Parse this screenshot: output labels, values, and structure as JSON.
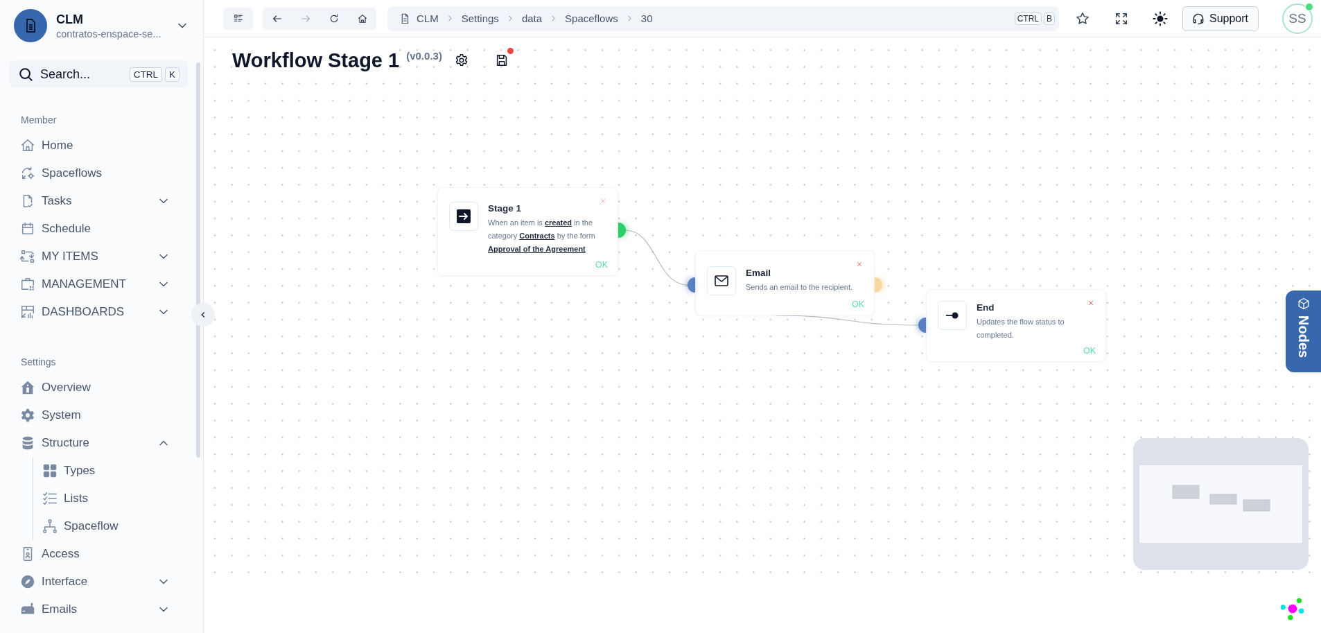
{
  "sidebar": {
    "workspace": {
      "name": "CLM",
      "subtitle": "contratos-enspace-se..."
    },
    "search": {
      "label": "Search...",
      "keys": [
        "CTRL",
        "K"
      ]
    },
    "sections": [
      {
        "title": "Member",
        "items": [
          {
            "label": "Home"
          },
          {
            "label": "Spaceflows"
          },
          {
            "label": "Tasks",
            "expanded": false
          },
          {
            "label": "Schedule"
          },
          {
            "label": "MY ITEMS",
            "expanded": false
          },
          {
            "label": "MANAGEMENT",
            "expanded": false
          },
          {
            "label": "DASHBOARDS",
            "expanded": false
          }
        ]
      },
      {
        "title": "Settings",
        "items": [
          {
            "label": "Overview"
          },
          {
            "label": "System"
          },
          {
            "label": "Structure",
            "expanded": true,
            "children": [
              {
                "label": "Types"
              },
              {
                "label": "Lists"
              },
              {
                "label": "Spaceflow"
              }
            ]
          },
          {
            "label": "Access"
          },
          {
            "label": "Interface",
            "expanded": false
          },
          {
            "label": "Emails",
            "expanded": false
          }
        ]
      }
    ]
  },
  "toolbar": {
    "nav_buttons": [
      {
        "kind": "back",
        "disabled": false
      },
      {
        "kind": "forward",
        "disabled": true
      },
      {
        "kind": "reload",
        "disabled": false
      },
      {
        "kind": "home",
        "disabled": false
      }
    ],
    "breadcrumbs": [
      "CLM",
      "Settings",
      "data",
      "Spaceflows",
      "30"
    ],
    "shortcut": [
      "CTRL",
      "B"
    ],
    "support": "Support",
    "avatar": {
      "initials": "SS",
      "online": true
    }
  },
  "workflow": {
    "title": "Workflow Stage 1",
    "version": "(v0.0.3)",
    "unsaved": true,
    "nodes": [
      {
        "kind": "trigger",
        "title": "Stage 1",
        "description": "When an item is **created** in the category **Contracts** by the form **Approval of the Agreement**",
        "status": "OK",
        "input": false,
        "output": true
      },
      {
        "kind": "email",
        "title": "Email",
        "description": "Sends an email to the recipient.",
        "status": "OK",
        "input": true,
        "output": true
      },
      {
        "kind": "end",
        "title": "End",
        "description": "Updates the flow status to completed.",
        "status": "OK",
        "input": true,
        "output": false
      }
    ],
    "nodes_panel": "Nodes"
  }
}
